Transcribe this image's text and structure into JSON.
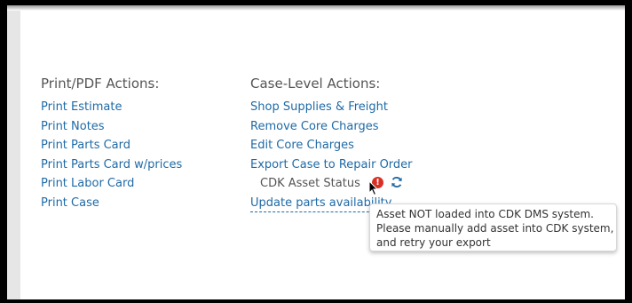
{
  "print_actions": {
    "heading": "Print/PDF Actions:",
    "items": [
      {
        "label": "Print Estimate"
      },
      {
        "label": "Print Notes"
      },
      {
        "label": "Print Parts Card"
      },
      {
        "label": "Print Parts Card w/prices"
      },
      {
        "label": "Print Labor Card"
      },
      {
        "label": "Print Case"
      }
    ]
  },
  "case_actions": {
    "heading": "Case-Level Actions:",
    "items": [
      {
        "label": "Shop Supplies & Freight"
      },
      {
        "label": "Remove Core Charges"
      },
      {
        "label": "Edit Core Charges"
      },
      {
        "label": "Export Case to Repair Order"
      }
    ],
    "cdk_status_label": "CDK Asset Status",
    "status_icon_glyph": "!",
    "status_color": "#d93025",
    "update_link": "Update parts availability"
  },
  "tooltip": {
    "line1": "Asset NOT loaded into CDK DMS system.",
    "line2": "Please manually add asset into CDK system,",
    "line3": "and retry your export"
  },
  "colors": {
    "link": "#1f6aa6",
    "heading": "#555555"
  }
}
